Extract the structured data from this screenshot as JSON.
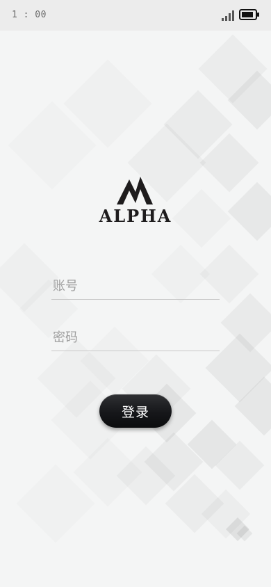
{
  "status_bar": {
    "time": "1 : 00",
    "signal_icon": "signal-icon",
    "battery_icon": "battery-icon"
  },
  "logo": {
    "icon": "alpha-logo-icon",
    "text": "ALPHA",
    "color": "#1e1c1d"
  },
  "login_form": {
    "account": {
      "placeholder": "账号",
      "value": ""
    },
    "password": {
      "placeholder": "密码",
      "value": ""
    },
    "submit_label": "登录"
  },
  "colors": {
    "background": "#f4f5f5",
    "status_bar": "#ececec",
    "button": "#16171a",
    "button_text": "#ffffff",
    "divider": "#c8c8c8"
  }
}
